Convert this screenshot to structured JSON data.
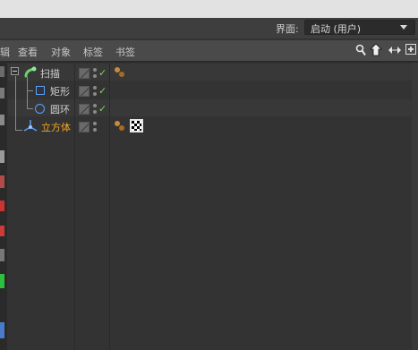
{
  "layout_bar": {
    "label": "界面:",
    "selected": "启动 (用户)"
  },
  "menu": {
    "items": [
      "辑",
      "查看",
      "对象",
      "标签",
      "书签"
    ]
  },
  "toolbar_icons": [
    "search-icon",
    "home-icon",
    "arrows-lr-icon",
    "add-panel-icon"
  ],
  "objects": [
    {
      "name": "扫描",
      "icon": "sweep-icon",
      "expanded": true,
      "selected": false,
      "check": "✓",
      "tags": [
        "phong-tag-icon"
      ]
    },
    {
      "name": "矩形",
      "icon": "rectangle-icon",
      "expanded": false,
      "selected": false,
      "check": "✓",
      "tags": []
    },
    {
      "name": "圆环",
      "icon": "circle-icon",
      "expanded": false,
      "selected": false,
      "check": "✓",
      "tags": []
    },
    {
      "name": "立方体",
      "icon": "cube-icon",
      "expanded": false,
      "selected": true,
      "check": "",
      "tags": [
        "phong-tag-icon",
        "checker-material-icon"
      ]
    }
  ],
  "colors": {
    "selected_text": "#f6a623",
    "check": "#7ed36a",
    "background": "#333333"
  }
}
